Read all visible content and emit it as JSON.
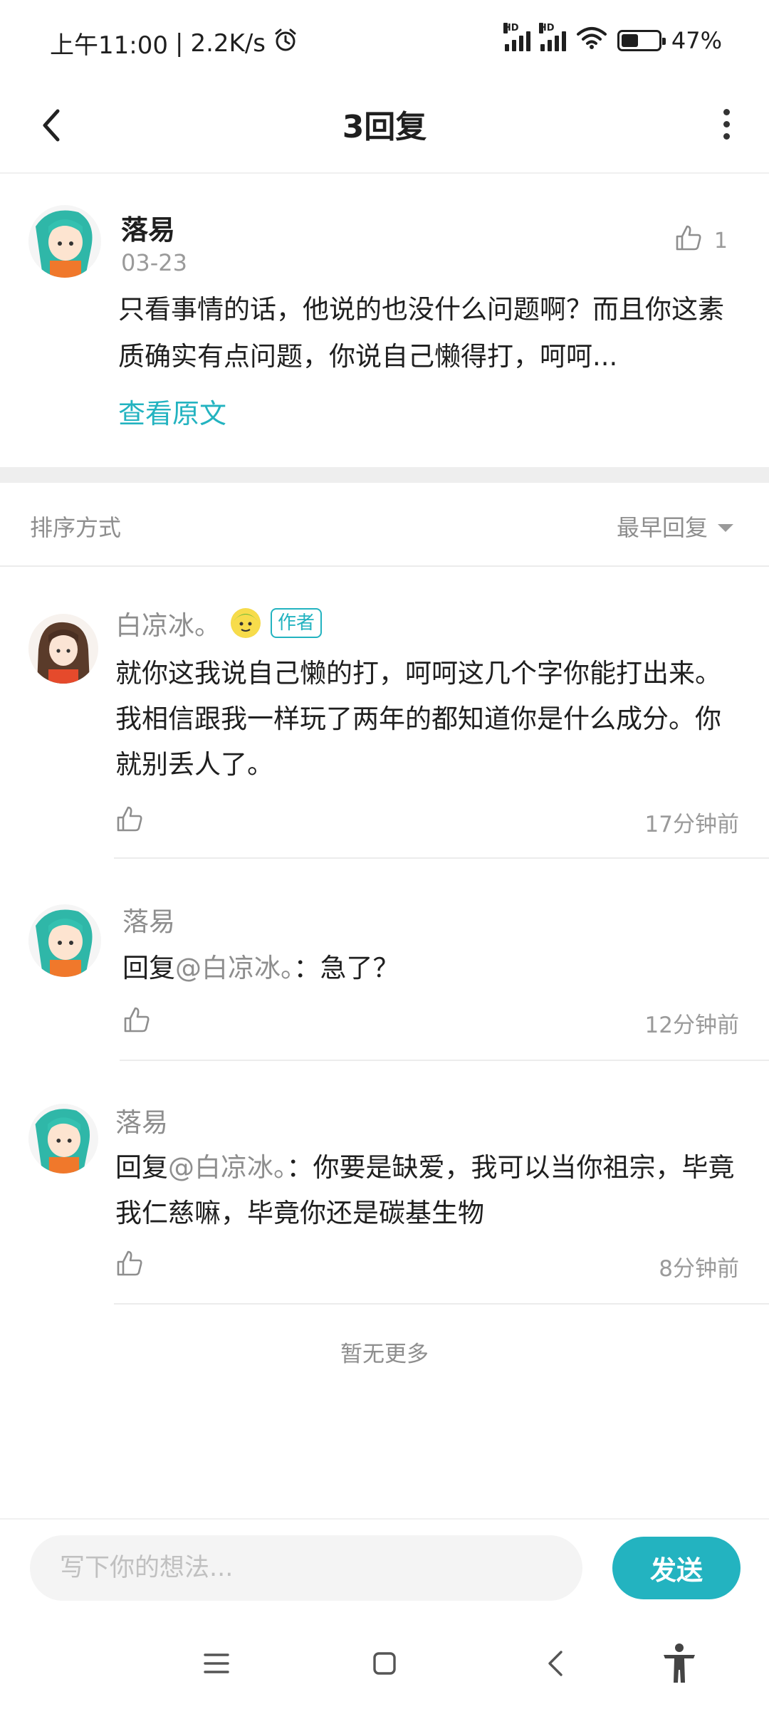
{
  "status_bar": {
    "time": "上午11:00",
    "speed": "2.2K/s",
    "separator": "|",
    "battery": "47%",
    "battery_level": 0.47,
    "icons": [
      "alarm-icon",
      "signal-hd-icon",
      "signal-hd-icon",
      "wifi-icon",
      "battery-icon"
    ]
  },
  "header": {
    "title": "3回复",
    "back_icon": "chevron-left-icon",
    "more_icon": "more-vertical-icon"
  },
  "post": {
    "author": "落易",
    "date": "03-23",
    "likes": "1",
    "text": "只看事情的话，他说的也没什么问题啊？而且你这素质确实有点问题，你说自己懒得打，呵呵...",
    "view_original": "查看原文"
  },
  "sort": {
    "label": "排序方式",
    "value": "最早回复"
  },
  "replies": [
    {
      "name": "白凉冰。",
      "badge": "作者",
      "text": "就你这我说自己懒的打，呵呵这几个字你能打出来。我相信跟我一样玩了两年的都知道你是什么成分。你就别丢人了。",
      "time": "17分钟前"
    },
    {
      "name": "落易",
      "reply_prefix": "回复",
      "mention": "@白凉冰。",
      "text": "：急了？",
      "time": "12分钟前"
    },
    {
      "name": "落易",
      "reply_prefix": "回复",
      "mention": "@白凉冰。",
      "text": "：你要是缺爱，我可以当你祖宗，毕竟我仁慈嘛，毕竟你还是碳基生物",
      "time": "8分钟前"
    }
  ],
  "footer": {
    "no_more": "暂无更多"
  },
  "input": {
    "placeholder": "写下你的想法...",
    "send": "发送"
  },
  "nav": {
    "icons": [
      "menu-icon",
      "home-square-icon",
      "back-triangle-icon",
      "accessibility-icon"
    ]
  },
  "colors": {
    "accent": "#23b3c0",
    "muted_text": "#8e8e8e",
    "divider": "#ececec"
  }
}
